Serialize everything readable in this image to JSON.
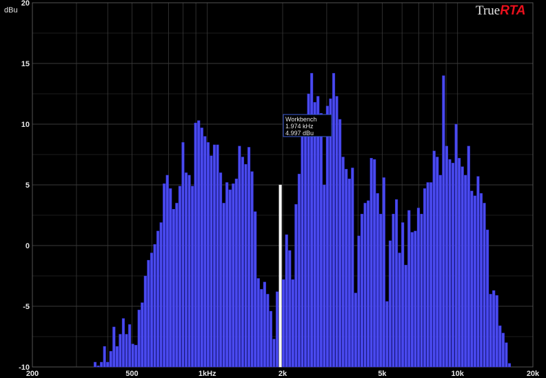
{
  "brand": {
    "name_plain": "True",
    "name_accent": "RTA",
    "accent_color": "#e8101c"
  },
  "colors": {
    "background": "#000000",
    "bar": "#4a4aee",
    "bar_edge": "#2a2ad0",
    "grid": "#3a3a3a",
    "text": "#e6e6e6",
    "highlight_bar": "#ffffff"
  },
  "tooltip": {
    "title": "Workbench",
    "frequency": "1.974 kHz",
    "level": "4.997 dBu"
  },
  "chart_data": {
    "type": "bar",
    "title": "",
    "xlabel": "",
    "ylabel": "dBu",
    "x_scale": "log",
    "xlim": [
      200,
      20000
    ],
    "ylim": [
      -10,
      20
    ],
    "grid": true,
    "y_ticks": [
      20,
      15,
      10,
      5,
      0,
      -5,
      -10
    ],
    "y_tick_labels": [
      "20",
      "15",
      "10",
      "5",
      "0",
      "-5",
      "-10"
    ],
    "x_ticks": [
      200,
      500,
      1000,
      2000,
      5000,
      10000,
      20000
    ],
    "x_tick_labels": [
      "200",
      "500",
      "1kHz",
      "2k",
      "5k",
      "10k",
      "20k"
    ],
    "highlighted": {
      "frequency_hz": 1974,
      "value": 4.997
    },
    "series": [
      {
        "name": "Workbench",
        "start_freq_hz": 200,
        "bands_per_octave": 24,
        "values": [
          -10,
          -10,
          -10,
          -10,
          -10,
          -10,
          -10,
          -10,
          -10,
          -10,
          -10,
          -10,
          -10,
          -10,
          -10,
          -10,
          -10,
          -10,
          -10,
          -10,
          -9.6,
          -9.9,
          -9.6,
          -8.3,
          -9.6,
          -8.7,
          -6.7,
          -8.3,
          -7.3,
          -6,
          -7.3,
          -6.5,
          -8.1,
          -8.2,
          -5.3,
          -4.7,
          -2.5,
          -1.2,
          -0.6,
          0.1,
          1.2,
          1.9,
          5.1,
          5.8,
          4.7,
          3.0,
          3.5,
          4.9,
          8.5,
          6.0,
          5.8,
          4.9,
          10.1,
          10.3,
          9.7,
          9.0,
          8.5,
          7.4,
          8.3,
          8.3,
          6.0,
          3.5,
          5.2,
          4.6,
          5.1,
          5.5,
          8.2,
          7.3,
          6.7,
          8.1,
          6.1,
          2.8,
          -2.7,
          -3.6,
          -3.0,
          -4.0,
          -5.4,
          -7.7,
          -3.8,
          -8.0,
          -2.8,
          0.9,
          -0.4,
          -2.8,
          3.4,
          5.9,
          9.2,
          10.0,
          12.5,
          14.2,
          11.8,
          12.3,
          10.9,
          5.0,
          11.5,
          12.1,
          14.2,
          12.3,
          10.4,
          7.3,
          6.3,
          5.5,
          6.4,
          -3.9,
          0.8,
          2.6,
          3.5,
          3.7,
          7.2,
          7.1,
          4.3,
          2.6,
          5.6,
          -4.6,
          0.4,
          2.6,
          3.8,
          -0.6,
          1.9,
          -1.6,
          2.9,
          1.1,
          1.2,
          3.1,
          2.6,
          4.7,
          5.2,
          5.2,
          7.8,
          7.3,
          5.8,
          14.0,
          8.2,
          7.1,
          6.8,
          10.0,
          7.2,
          6.5,
          5.8,
          8.2,
          4.5,
          4.1,
          5.7,
          4.3,
          3.5,
          1.3,
          -4,
          -3.7,
          -4.1,
          -6.6,
          -7.2,
          -8,
          -9.7,
          -10,
          -10,
          -10,
          -10,
          -10,
          -10,
          -10,
          -10,
          -10,
          -10,
          -10,
          -10
        ]
      }
    ]
  }
}
